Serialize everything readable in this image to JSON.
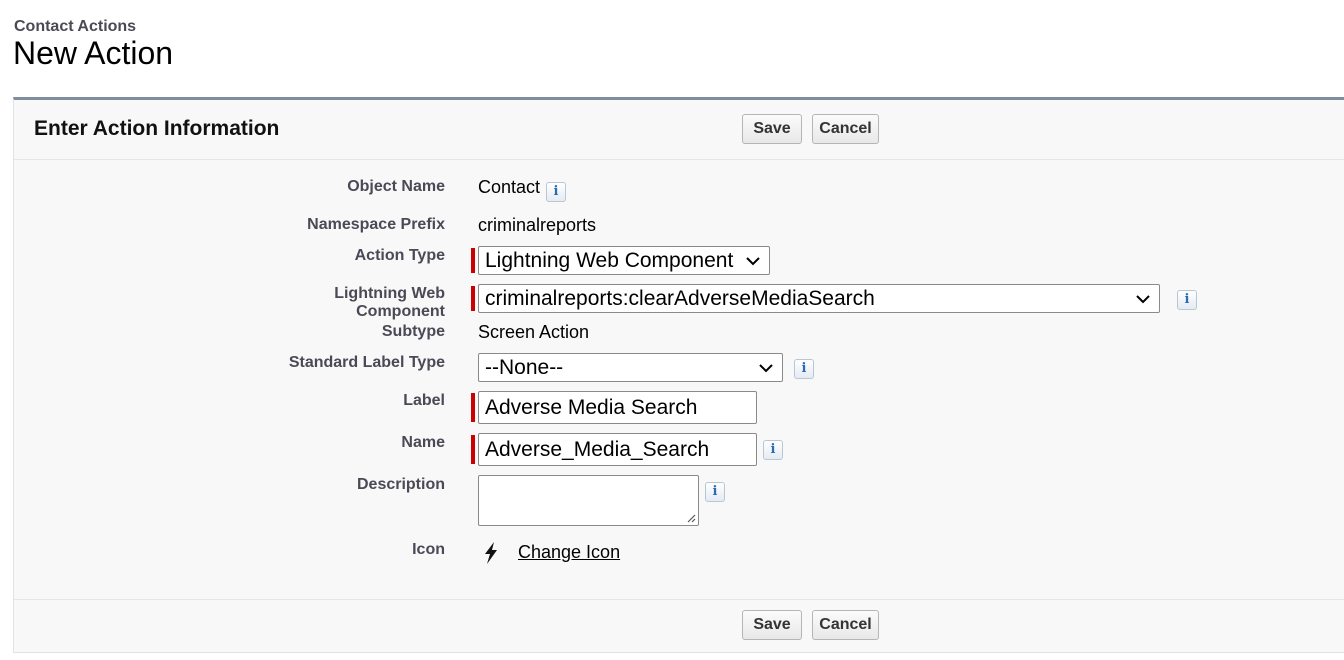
{
  "header": {
    "breadcrumb": "Contact Actions",
    "title": "New Action"
  },
  "panel": {
    "title": "Enter Action Information",
    "save_label": "Save",
    "cancel_label": "Cancel"
  },
  "fields": {
    "object_name": {
      "label": "Object Name",
      "value": "Contact"
    },
    "namespace_prefix": {
      "label": "Namespace Prefix",
      "value": "criminalreports"
    },
    "action_type": {
      "label": "Action Type",
      "value": "Lightning Web Component"
    },
    "lwc": {
      "label": "Lightning Web Component",
      "value": "criminalreports:clearAdverseMediaSearch"
    },
    "subtype": {
      "label": "Subtype",
      "value": "Screen Action"
    },
    "standard_label_type": {
      "label": "Standard Label Type",
      "value": "--None--"
    },
    "label": {
      "label": "Label",
      "value": "Adverse Media Search"
    },
    "name": {
      "label": "Name",
      "value": "Adverse_Media_Search"
    },
    "description": {
      "label": "Description",
      "value": ""
    },
    "icon": {
      "label": "Icon",
      "link": "Change Icon",
      "icon_name": "lightning-bolt-icon"
    }
  },
  "colors": {
    "required": "#cc0000",
    "panel_top_border": "#7f8d9c",
    "label_text": "#4a4a56"
  }
}
